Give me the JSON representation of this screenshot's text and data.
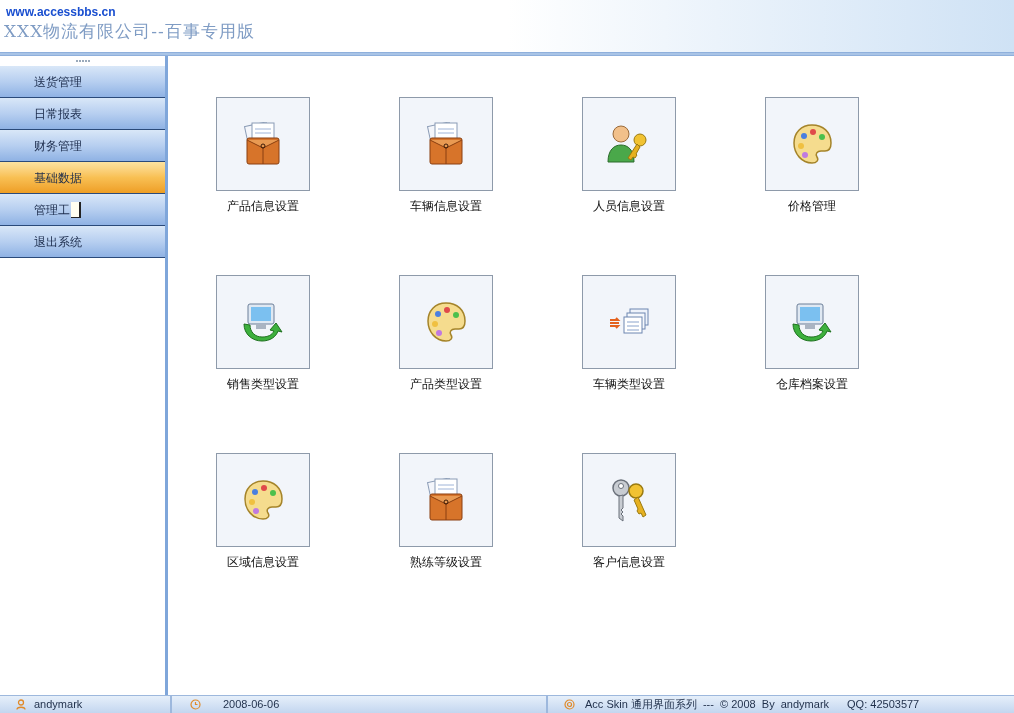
{
  "header": {
    "site": "www.accessbbs.cn",
    "title": "XXX物流有限公司--百事专用版"
  },
  "sidebar": {
    "items": [
      {
        "label": "送货管理",
        "selected": false
      },
      {
        "label": "日常报表",
        "selected": false
      },
      {
        "label": "财务管理",
        "selected": false
      },
      {
        "label": "基础数据",
        "selected": true
      },
      {
        "label": "管理工",
        "selected": false
      },
      {
        "label": "退出系统",
        "selected": false
      }
    ]
  },
  "tiles": [
    {
      "label": "产品信息设置",
      "kind": "folder"
    },
    {
      "label": "车辆信息设置",
      "kind": "folder"
    },
    {
      "label": "人员信息设置",
      "kind": "person"
    },
    {
      "label": "价格管理",
      "kind": "palette"
    },
    {
      "label": "销售类型设置",
      "kind": "monitor"
    },
    {
      "label": "产品类型设置",
      "kind": "palette"
    },
    {
      "label": "车辆类型设置",
      "kind": "list"
    },
    {
      "label": "仓库档案设置",
      "kind": "monitor"
    },
    {
      "label": "区域信息设置",
      "kind": "palette"
    },
    {
      "label": "熟练等级设置",
      "kind": "folder"
    },
    {
      "label": "客户信息设置",
      "kind": "keys"
    }
  ],
  "status_bar": {
    "user": "andymark",
    "date": "2008-06-06",
    "credits": "Acc Skin 通用界面系列  ---  © 2008  By  andymark",
    "qq": "QQ: 42503577"
  }
}
